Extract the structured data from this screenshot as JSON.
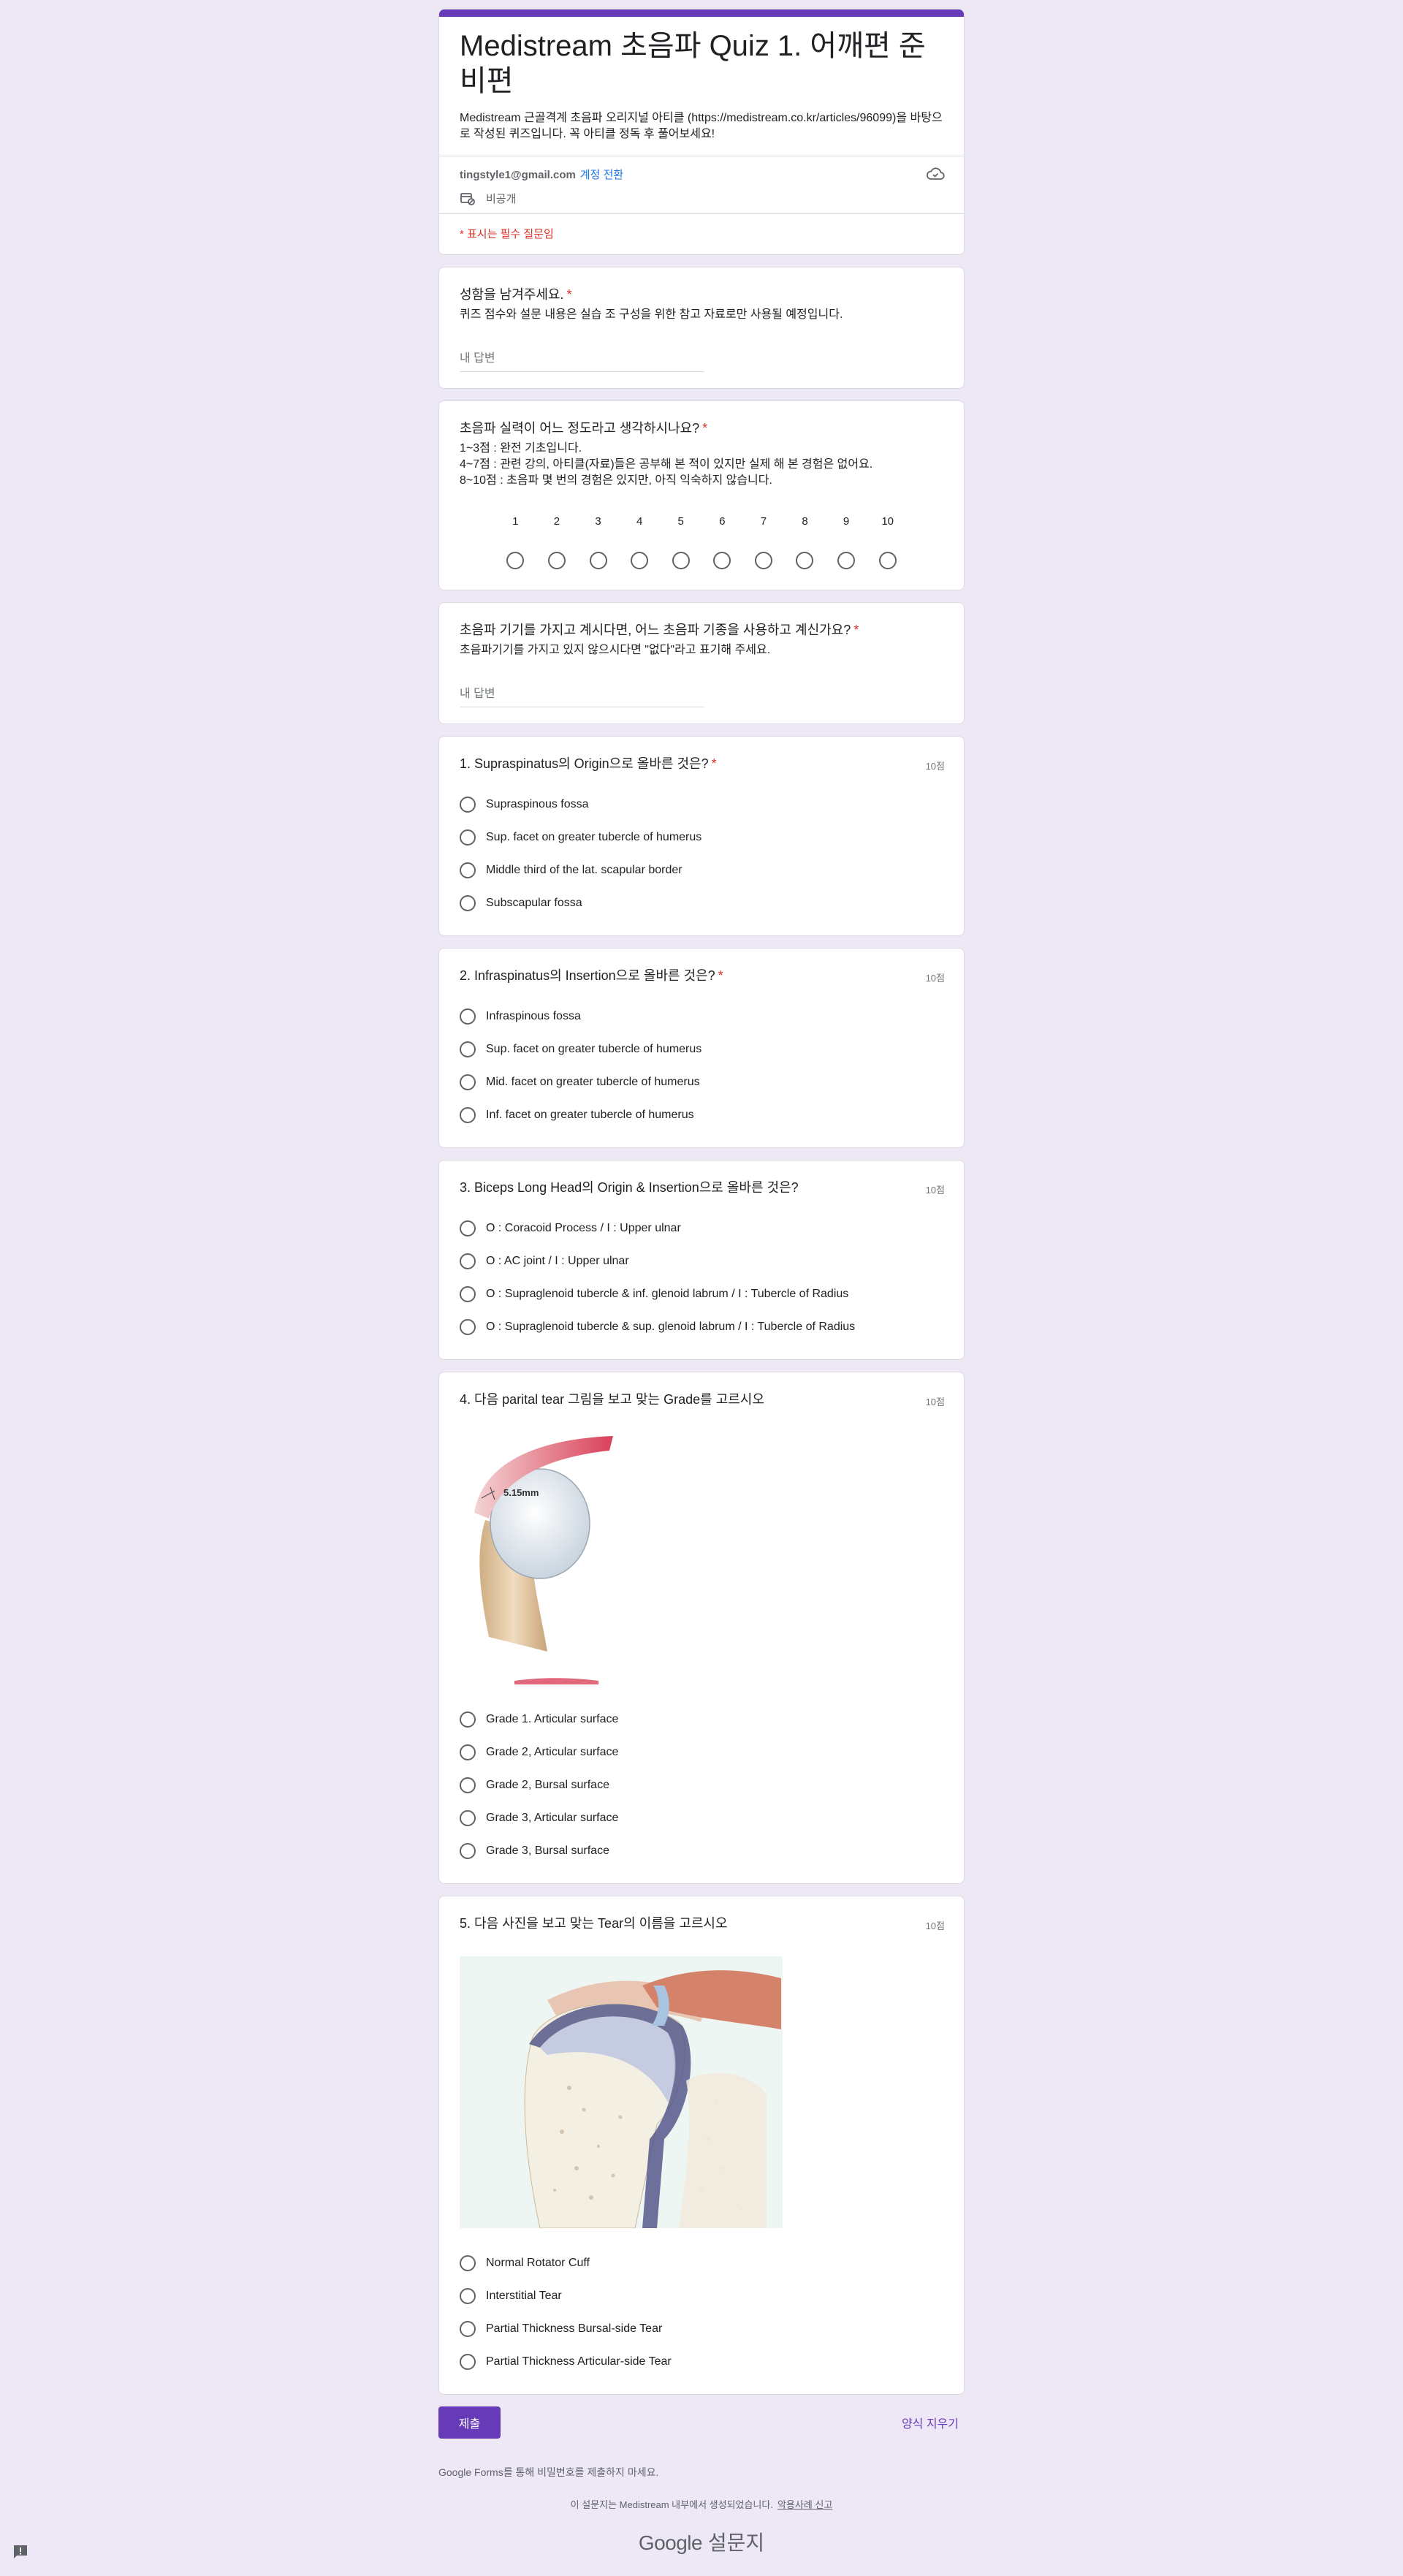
{
  "form": {
    "title": "Medistream 초음파 Quiz 1. 어깨편 준비편",
    "description": "Medistream 근골격계 초음파 오리지널 아티클 (https://medistream.co.kr/articles/96099)을 바탕으로 작성된 퀴즈입니다. 꼭 아티클 정독 후 풀어보세요!",
    "account_email": "tingstyle1@gmail.com",
    "switch_account": "계정 전환",
    "privacy": "비공개",
    "required_note": "* 표시는 필수 질문임"
  },
  "q_name": {
    "title": "성함을 남겨주세요.",
    "star": "*",
    "description": "퀴즈 점수와 설문 내용은 실습 조 구성을 위한 참고 자료로만 사용될 예정입니다.",
    "placeholder": "내 답변"
  },
  "q_skill": {
    "title": "초음파 실력이 어느 정도라고 생각하시나요?",
    "star": "*",
    "description": "1~3점 :  완전 기초입니다.\n4~7점 : 관련 강의, 아티클(자료)들은 공부해 본 적이 있지만 실제 해 본 경험은 없어요.\n8~10점 : 초음파 몇 번의 경험은 있지만, 아직 익숙하지 않습니다.",
    "scale": [
      "1",
      "2",
      "3",
      "4",
      "5",
      "6",
      "7",
      "8",
      "9",
      "10"
    ]
  },
  "q_device": {
    "title": "초음파 기기를 가지고 계시다면, 어느 초음파 기종을 사용하고 계신가요?",
    "star": "*",
    "description": "초음파기기를 가지고 있지 않으시다면 \"없다\"라고 표기해 주세요.",
    "placeholder": "내 답변"
  },
  "q1": {
    "title": "1. Supraspinatus의 Origin으로 올바른 것은?",
    "star": "*",
    "points": "10점",
    "options": [
      "Supraspinous fossa",
      "Sup. facet on greater tubercle of humerus",
      "Middle third of the lat. scapular border",
      "Subscapular fossa"
    ]
  },
  "q2": {
    "title": "2. Infraspinatus의 Insertion으로 올바른 것은?",
    "star": "*",
    "points": "10점",
    "options": [
      "Infraspinous fossa",
      "Sup. facet on greater tubercle of humerus",
      "Mid. facet on greater tubercle of humerus",
      "Inf. facet on greater tubercle of humerus"
    ]
  },
  "q3": {
    "title": "3. Biceps Long Head의 Origin & Insertion으로 올바른 것은?",
    "points": "10점",
    "options": [
      "O : Coracoid Process / I : Upper ulnar",
      "O : AC joint / I : Upper ulnar",
      "O : Supraglenoid tubercle & inf. glenoid labrum / I : Tubercle of Radius",
      "O : Supraglenoid tubercle & sup. glenoid labrum / I : Tubercle of Radius"
    ]
  },
  "q4": {
    "title": "4. 다음 parital tear 그림을 보고 맞는 Grade를 고르시오",
    "points": "10점",
    "image_label": "5.15mm",
    "options": [
      "Grade 1. Articular surface",
      "Grade 2, Articular surface",
      "Grade 2, Bursal surface",
      "Grade 3, Articular surface",
      "Grade 3, Bursal surface"
    ]
  },
  "q5": {
    "title": "5. 다음 사진을 보고 맞는 Tear의 이름을 고르시오",
    "points": "10점",
    "options": [
      "Normal Rotator Cuff",
      "Interstitial Tear",
      "Partial Thickness Bursal-side Tear",
      "Partial Thickness Articular-side Tear"
    ]
  },
  "footer": {
    "submit": "제출",
    "clear": "양식 지우기",
    "password_note": "Google Forms를 통해 비밀번호를 제출하지 마세요.",
    "made_by": "이 설문지는 Medistream 내부에서 생성되었습니다.",
    "report": "악용사례 신고",
    "brand_google": "Google",
    "brand_forms": "설문지"
  },
  "colors": {
    "accent": "#673ab7",
    "background": "#ede7f6",
    "required": "#d93025",
    "link": "#1a73e8"
  }
}
